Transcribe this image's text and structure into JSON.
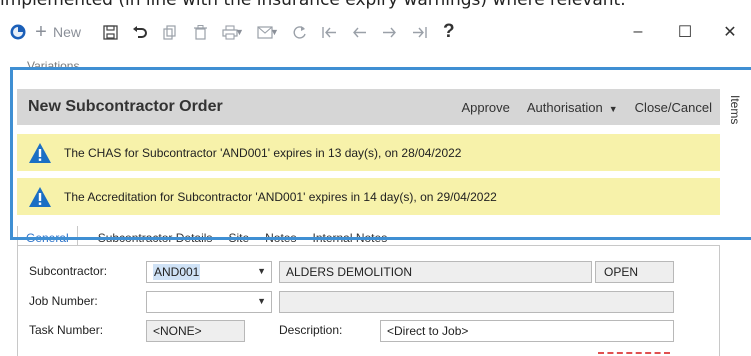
{
  "top_text": "implemented (in line with the insurance expiry warnings) where relevant.",
  "toolbar": {
    "new_label": "New",
    "help_label": "?"
  },
  "window": {
    "min": "–",
    "max": "☐",
    "close": "✕"
  },
  "section_label": "Variations",
  "order": {
    "title": "New Subcontractor Order",
    "actions": {
      "approve": "Approve",
      "authorisation": "Authorisation",
      "close_cancel": "Close/Cancel"
    },
    "items_tab": "Items"
  },
  "warnings": [
    "The CHAS for Subcontractor 'AND001' expires in 13 day(s), on 28/04/2022",
    "The Accreditation for Subcontractor 'AND001' expires in 14 day(s), on 29/04/2022"
  ],
  "tabs": [
    "General",
    "Subcontractor Details",
    "Site",
    "Notes",
    "Internal Notes"
  ],
  "form": {
    "subcontractor_label": "Subcontractor:",
    "subcontractor_value": "AND001",
    "subcontractor_name": "ALDERS DEMOLITION",
    "status": "OPEN",
    "job_number_label": "Job Number:",
    "job_number_value": "",
    "job_desc_value": "",
    "task_number_label": "Task Number:",
    "task_number_value": "<NONE>",
    "description_label": "Description:",
    "description_value": "<Direct to Job>"
  },
  "colors": {
    "highlight": "#3f8fd3",
    "warning_bg": "#f7f2aa",
    "header_bg": "#d6d6d6",
    "warn_icon": "#1b6fc4"
  },
  "icons": [
    "app-icon",
    "plus-icon",
    "save-icon",
    "undo-icon",
    "copy-icon",
    "delete-icon",
    "print-icon",
    "email-icon",
    "refresh-icon",
    "first-icon",
    "back-icon",
    "forward-icon",
    "last-icon",
    "help-icon",
    "warning-icon"
  ]
}
